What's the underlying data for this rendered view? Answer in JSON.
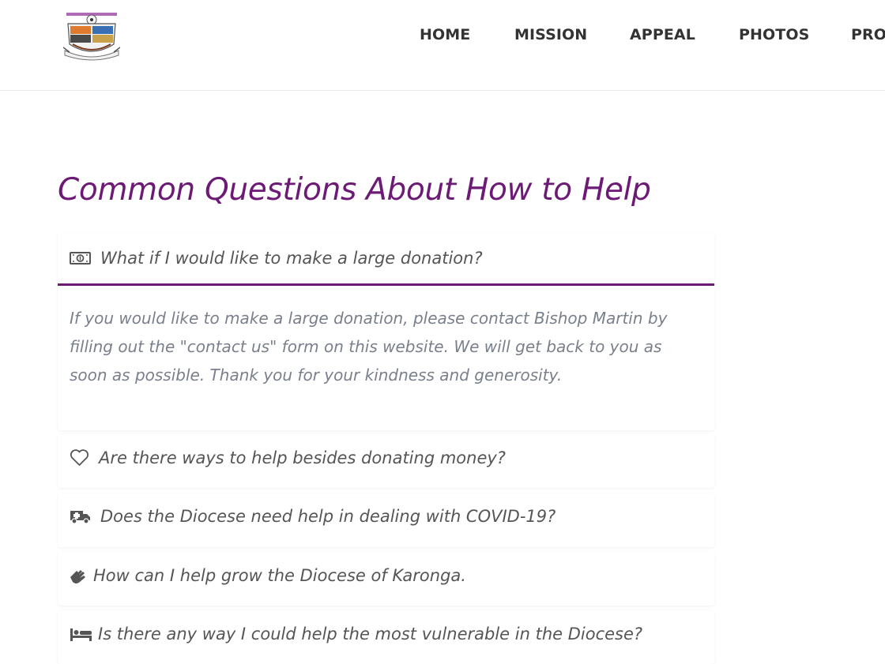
{
  "header": {
    "logo_icon": "diocese-crest-logo",
    "nav": [
      {
        "label": "HOME"
      },
      {
        "label": "MISSION"
      },
      {
        "label": "APPEAL"
      },
      {
        "label": "PHOTOS"
      },
      {
        "label": "PRO"
      }
    ]
  },
  "main": {
    "title": "Common Questions About How to Help",
    "faq": [
      {
        "icon": "money-bill-icon",
        "question": "What if I would like to make a large donation?",
        "answer": "If you would like to make a large donation, please contact Bishop Martin by filling out the \"contact us\" form on this website. We will get back to you as soon as possible. Thank you for your kindness and generosity.",
        "expanded": true
      },
      {
        "icon": "heart-icon",
        "question": "Are there ways to help besides donating money?",
        "expanded": false
      },
      {
        "icon": "ambulance-icon",
        "question": "Does the Diocese need help in dealing with COVID-19?",
        "expanded": false
      },
      {
        "icon": "sign-language-icon",
        "question": "How can I help grow the Diocese of Karonga.",
        "expanded": false
      },
      {
        "icon": "bed-icon",
        "question": "Is there any way I could help the most vulnerable in the Diocese?",
        "expanded": false
      }
    ]
  },
  "colors": {
    "accent": "#6d1a76",
    "nav_text": "#333333",
    "question_text": "#555555",
    "answer_text": "#7a7f8c"
  }
}
